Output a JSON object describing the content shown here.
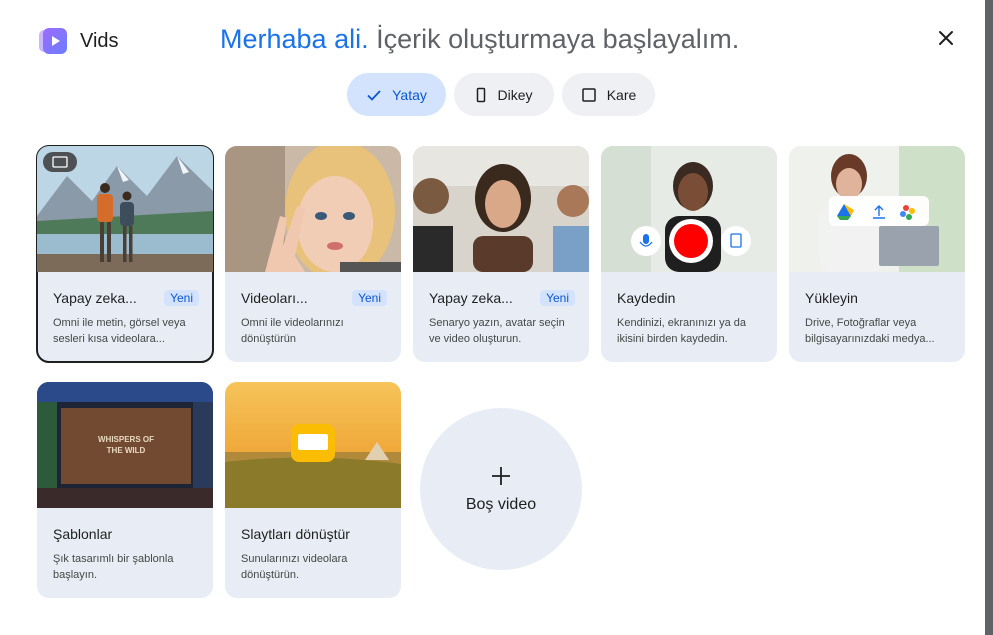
{
  "app": {
    "name": "Vids",
    "logo_icon": "vids-logo-icon"
  },
  "header": {
    "greeting_name": "Merhaba ali.",
    "greeting_rest": "İçerik oluşturmaya başlayalım.",
    "close_icon": "close-icon"
  },
  "orientation": {
    "selected": "Yatay",
    "options": [
      {
        "label": "Yatay",
        "icon": "check-icon"
      },
      {
        "label": "Dikey",
        "icon": "portrait-icon"
      },
      {
        "label": "Kare",
        "icon": "square-icon"
      }
    ]
  },
  "cards": [
    {
      "title": "Yapay zeka...",
      "badge": "Yeni",
      "desc": "Omni ile metin, görsel veya sesleri kısa videolara..."
    },
    {
      "title": "Videoları...",
      "badge": "Yeni",
      "desc": "Omni ile videolarınızı dönüştürün"
    },
    {
      "title": "Yapay zeka...",
      "badge": "Yeni",
      "desc": "Senaryo yazın, avatar seçin ve video oluşturun."
    },
    {
      "title": "Kaydedin",
      "desc": "Kendinizi, ekranınızı ya da ikisini birden kaydedin."
    },
    {
      "title": "Yükleyin",
      "desc": "Drive, Fotoğraflar veya bilgisayarınızdaki medya..."
    },
    {
      "title": "Şablonlar",
      "desc": "Şık tasarımlı bir şablonla başlayın.",
      "thumb_text_1": "WHISPERS OF",
      "thumb_text_2": "THE WILD"
    },
    {
      "title": "Slaytları dönüştür",
      "desc": "Sunularınızı videolara dönüştürün."
    }
  ],
  "blank": {
    "label": "Boş video",
    "icon": "plus-icon"
  },
  "colors": {
    "accent": "#1a73e8",
    "selected_chip": "#d3e3fd",
    "card_bg": "#e8edf5",
    "record_red": "#ff0000"
  }
}
